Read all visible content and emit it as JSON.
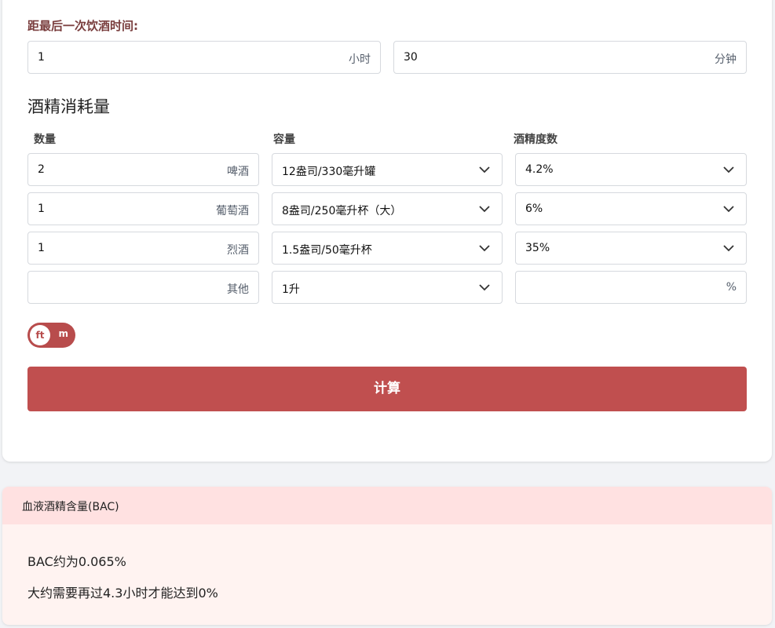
{
  "time_since": {
    "label": "距最后一次饮酒时间:",
    "hours_value": "1",
    "hours_unit": "小时",
    "minutes_value": "30",
    "minutes_unit": "分钟"
  },
  "consumption": {
    "title": "酒精消耗量",
    "headers": {
      "quantity": "数量",
      "volume": "容量",
      "abv": "酒精度数"
    },
    "rows": [
      {
        "quantity": "2",
        "type": "啤酒",
        "volume": "12盎司/330毫升罐",
        "abv": "4.2%"
      },
      {
        "quantity": "1",
        "type": "葡萄酒",
        "volume": "8盎司/250毫升杯（大）",
        "abv": "6%"
      },
      {
        "quantity": "1",
        "type": "烈酒",
        "volume": "1.5盎司/50毫升杯",
        "abv": "35%"
      },
      {
        "quantity": "",
        "type": "其他",
        "volume": "1升",
        "abv": "",
        "abv_unit": "%"
      }
    ]
  },
  "unit_toggle": {
    "selected": "ft",
    "other": "m"
  },
  "calculate_label": "计算",
  "result": {
    "title": "血液酒精含量(BAC)",
    "bac_text": "BAC约为0.065%",
    "time_text": "大约需要再过4.3小时才能达到0%"
  },
  "colors": {
    "accent": "#c04f4f",
    "label": "#7a3e3e",
    "result_bg": "#fff3f1",
    "result_head": "#ffe1e1"
  },
  "icons": {
    "dropdown": "chevron-down-icon"
  }
}
